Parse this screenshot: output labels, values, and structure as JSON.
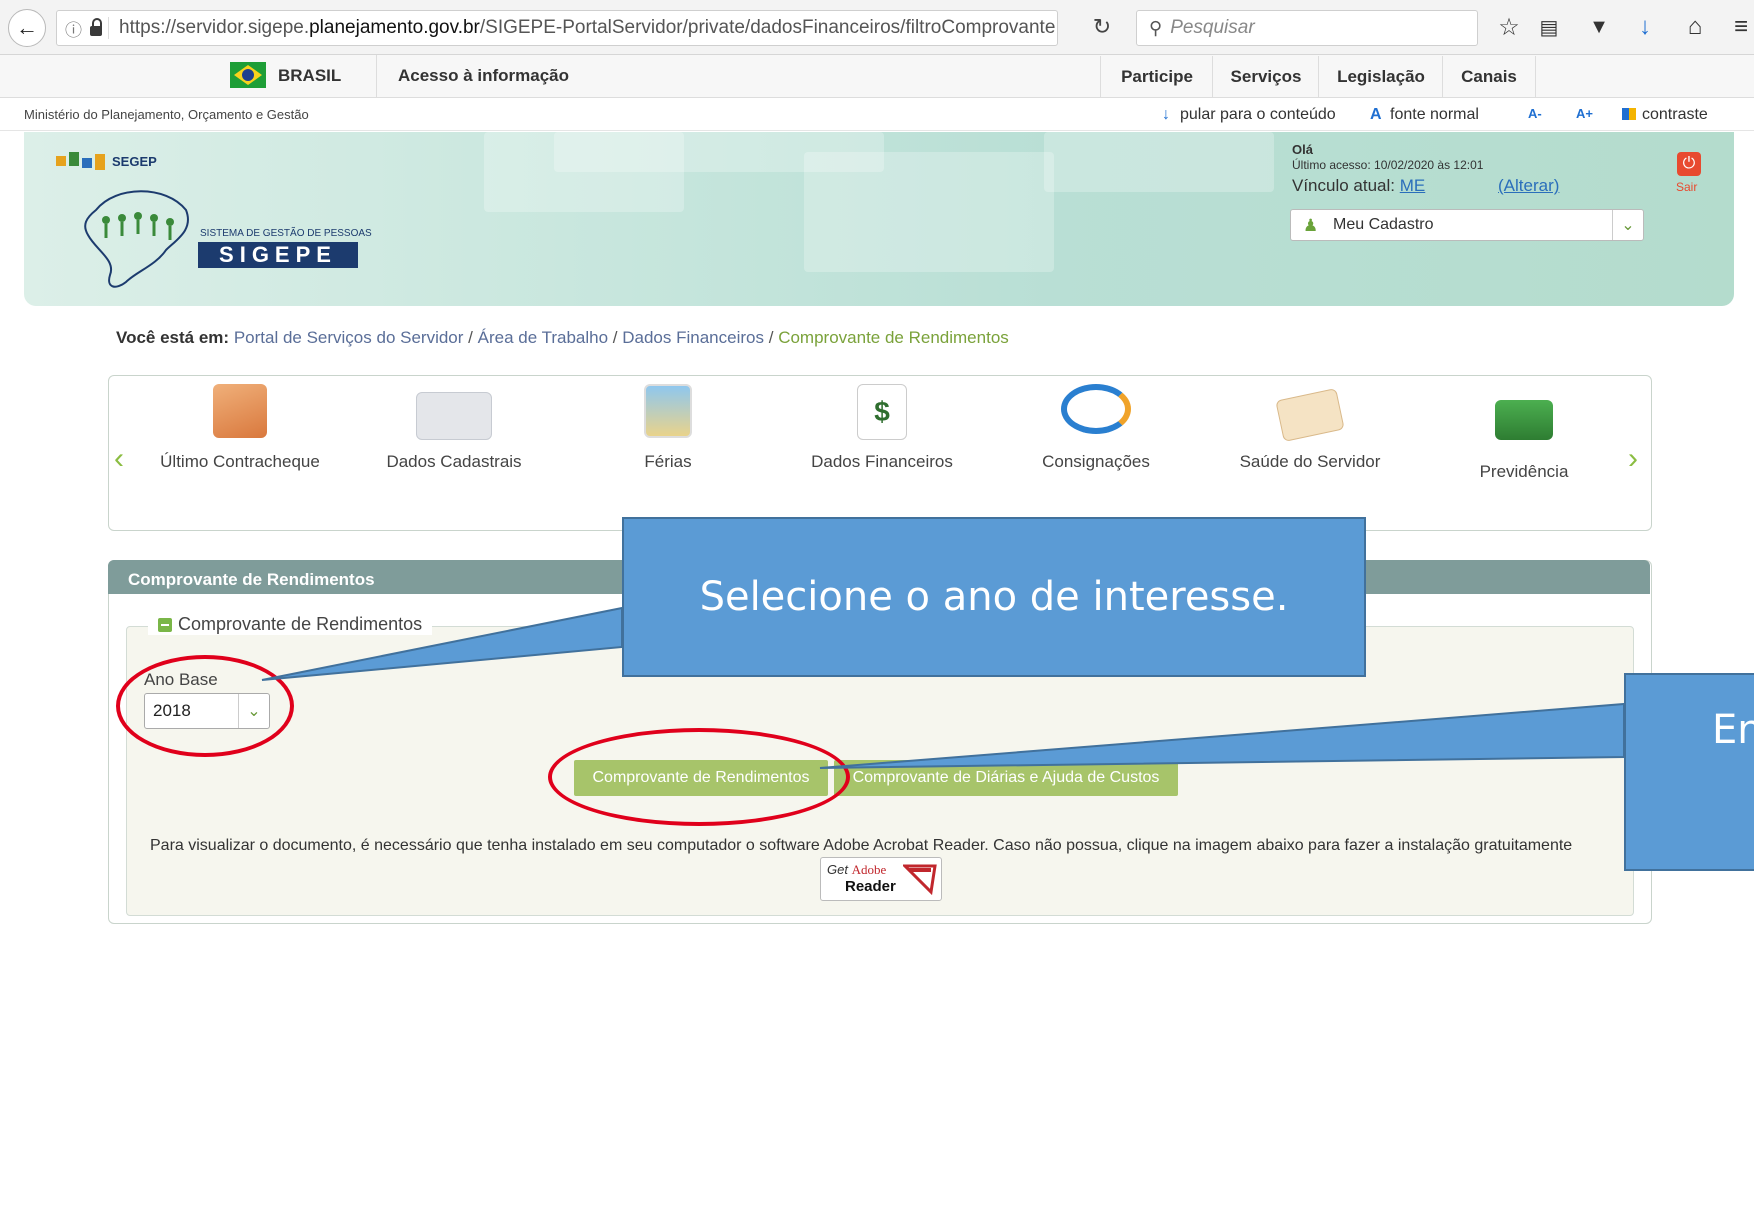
{
  "browser": {
    "url_prefix": "https://servidor.sigepe.",
    "url_domain": "planejamento.gov.br",
    "url_path": "/SIGEPE-PortalServidor/private/dadosFinanceiros/filtroComprovante",
    "search_placeholder": "Pesquisar"
  },
  "govbar": {
    "brasil": "BRASIL",
    "acesso": "Acesso à informação",
    "menu": [
      "Participe",
      "Serviços",
      "Legislação",
      "Canais"
    ]
  },
  "ministry": {
    "name": "Ministério do Planejamento, Orçamento e Gestão",
    "skip": "pular para o conteúdo",
    "font_normal": "fonte normal",
    "font_minus": "A-",
    "font_plus": "A+",
    "contrast": "contraste"
  },
  "header": {
    "segep": "SEGEP",
    "logo_sub": "SISTEMA DE GESTÃO DE PESSOAS",
    "logo": "SIGEPE",
    "greeting": "Olá",
    "last_access": "Último acesso: 10/02/2020 às 12:01",
    "vinculo_label": "Vínculo atual:",
    "vinculo_value": "ME",
    "alterar": "(Alterar)",
    "meu_cadastro": "Meu Cadastro",
    "sair": "Sair"
  },
  "breadcrumb": {
    "lead": "Você está em:",
    "items": [
      "Portal de Serviços do Servidor",
      "Área de Trabalho",
      "Dados Financeiros"
    ],
    "sep": "/",
    "current": "Comprovante de Rendimentos"
  },
  "services": [
    {
      "label": "Último Contracheque",
      "icon": "folder-icon"
    },
    {
      "label": "Dados Cadastrais",
      "icon": "id-card-icon"
    },
    {
      "label": "Férias",
      "icon": "beach-icon"
    },
    {
      "label": "Dados Financeiros",
      "icon": "money-icon"
    },
    {
      "label": "Consignações",
      "icon": "arrows-icon"
    },
    {
      "label": "Saúde do Servidor",
      "icon": "health-icon"
    },
    {
      "label": "Previdência",
      "icon": "growth-icon"
    }
  ],
  "panel": {
    "title": "Comprovante de Rendimentos",
    "legend": "Comprovante de Rendimentos",
    "ano_label": "Ano Base",
    "ano_value": "2018",
    "btn_rendimentos": "Comprovante de Rendimentos",
    "btn_diarias": "Comprovante de Diárias e Ajuda de Custos",
    "notice": "Para visualizar o documento, é necessário que tenha instalado em seu computador o software Adobe Acrobat Reader. Caso não possua, clique na imagem abaixo para fazer a instalação gratuitamente",
    "adobe_get": "Get",
    "adobe_brand": "Adobe",
    "adobe_reader": "Reader"
  },
  "callouts": {
    "first": "Selecione o ano de interesse.",
    "second": "En"
  },
  "colors": {
    "accent_green": "#a7c46a",
    "panel_head": "#7f9c9a",
    "callout_blue": "#5b9bd5",
    "highlight_red": "#e0001b"
  }
}
